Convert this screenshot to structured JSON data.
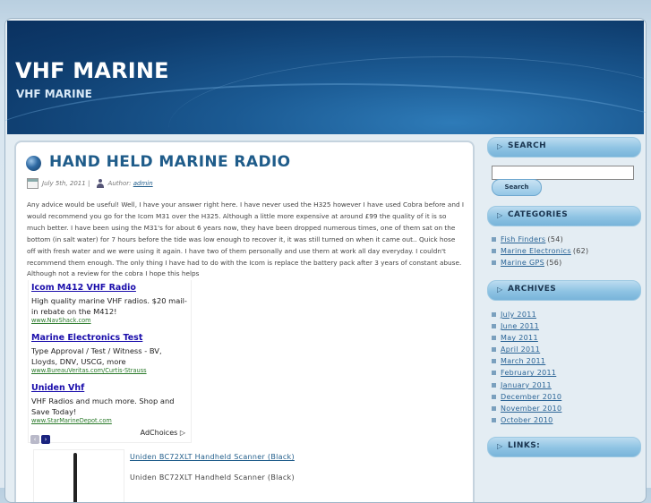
{
  "site": {
    "title": "VHF MARINE",
    "description": "VHF MARINE"
  },
  "post": {
    "title": "HAND HELD MARINE RADIO",
    "date": "July 5th, 2011",
    "separator": "|",
    "author_label": "Author:",
    "author": "admin",
    "body": "Any advice would be useful! Well, I have your answer right here. I have never used the H325 however I have used Cobra before and I would recommend you go for the Icom M31 over the H325. Although a little more expensive at around £99 the quality of it is so much better. I have been using the M31's for about 6 years now, they have been dropped numerous times, one of them sat on the bottom (in salt water) for 7 hours before the tide was low enough to recover it, it was still turned on when it came out.. Quick hose off with fresh water and we were using it again. I have two of them personally and use them at work all day everyday. I couldn't recommend them enough. The only thing I have had to do with the Icom is replace the battery pack after 3 years of constant abuse. Although not a review for the cobra I hope this helps"
  },
  "ads": [
    {
      "title": "Icom M412 VHF Radio",
      "text": "High quality marine VHF radios. $20 mail-in rebate on the M412!",
      "url": "www.NavShack.com"
    },
    {
      "title": "Marine Electronics Test",
      "text": "Type Approval / Test / Witness - BV, Lloyds, DNV, USCG, more",
      "url": "www.BureauVeritas.com/Curtis-Strauss"
    },
    {
      "title": "Uniden Vhf",
      "text": "VHF Radios and much more. Shop and Save Today!",
      "url": "www.StarMarineDepot.com"
    }
  ],
  "ad_nav": {
    "prev": "‹",
    "next": "›",
    "adchoices": "AdChoices ▷"
  },
  "product": {
    "link": "Uniden BC72XLT Handheld Scanner (Black)",
    "description": "Uniden BC72XLT Handheld Scanner (Black)"
  },
  "sidebar": {
    "search": {
      "title": "SEARCH",
      "button": "Search",
      "value": ""
    },
    "categories": {
      "title": "CATEGORIES",
      "items": [
        {
          "label": "Fish Finders",
          "count": "(54)"
        },
        {
          "label": "Marine Electronics",
          "count": "(62)"
        },
        {
          "label": "Marine GPS",
          "count": "(56)"
        }
      ]
    },
    "archives": {
      "title": "ARCHIVES",
      "items": [
        "July 2011",
        "June 2011",
        "May 2011",
        "April 2011",
        "March 2011",
        "February 2011",
        "January 2011",
        "December 2010",
        "November 2010",
        "October 2010"
      ]
    },
    "links": {
      "title": "LINKS:"
    }
  },
  "colors": {
    "header_bg": "#0e3c6d",
    "title_link": "#1f5c8a",
    "sidebar_bar": "#8ec3e3",
    "ad_link": "#1a0dab"
  }
}
